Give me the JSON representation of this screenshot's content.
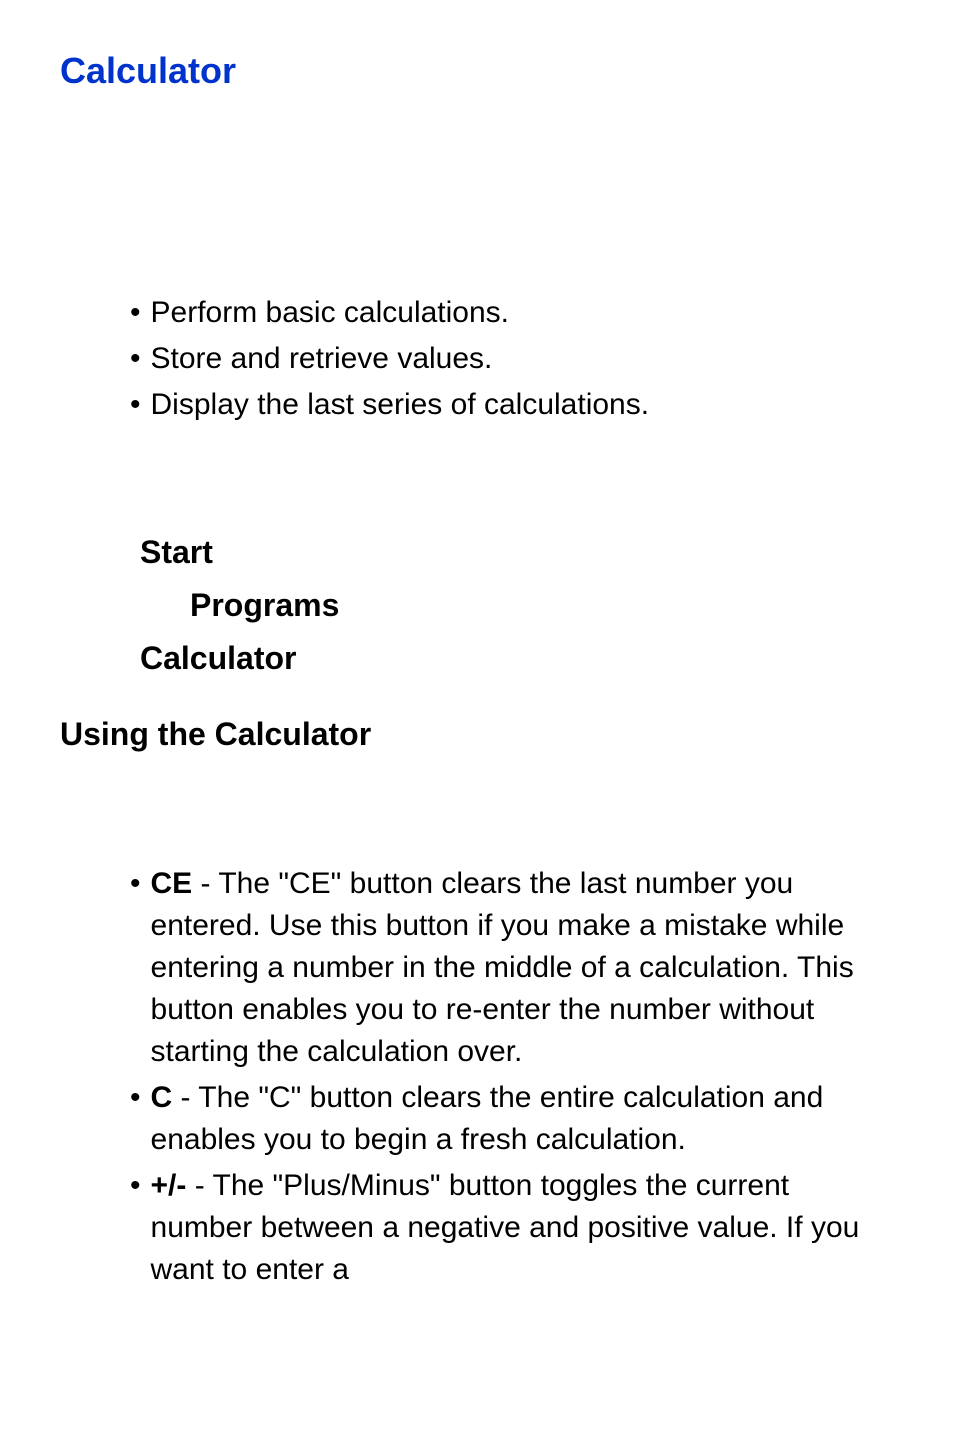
{
  "heading": "Calculator",
  "features": [
    "Perform basic calculations.",
    "Store and retrieve values.",
    "Display the last series of calculations."
  ],
  "nav": {
    "step1": "Start",
    "step2": "Programs",
    "step3": "Calculator"
  },
  "subheading": "Using the Calculator",
  "buttons": [
    {
      "label": "CE",
      "description": " - The \"CE\" button clears the last number you entered. Use this button if you make a mistake while entering a number in the middle of a calculation. This button enables you to re-enter the number without starting the calculation over."
    },
    {
      "label": "C",
      "description": " - The \"C\" button clears the entire calculation and enables you to begin a fresh calculation."
    },
    {
      "label": "+/-",
      "description": " - The \"Plus/Minus\" button toggles the current number between a negative and positive value. If you want to enter a"
    }
  ]
}
